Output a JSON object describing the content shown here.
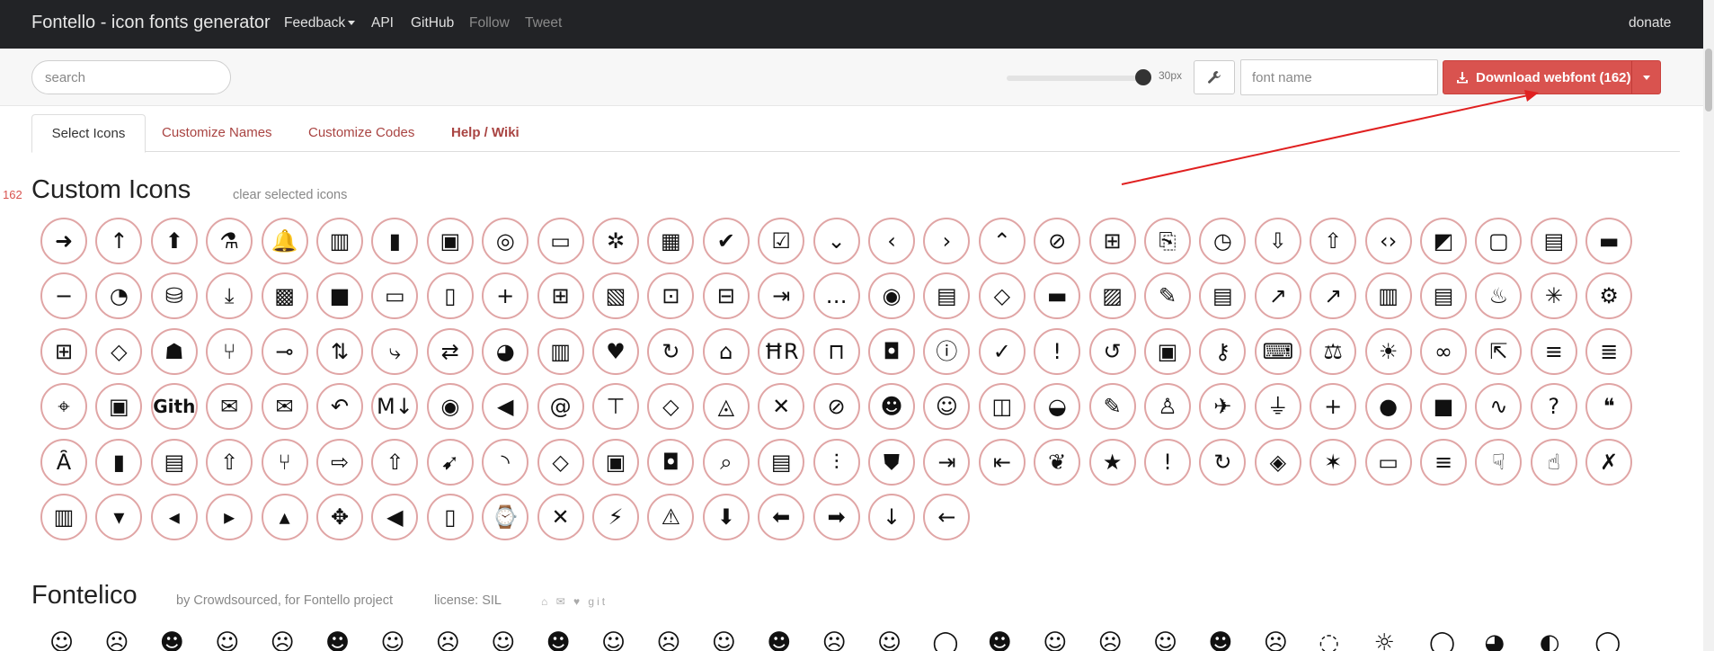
{
  "navbar": {
    "brand": "Fontello - icon fonts generator",
    "items": [
      {
        "label": "Feedback",
        "dropdown": true
      },
      {
        "label": "API"
      },
      {
        "label": "GitHub"
      },
      {
        "label": "Follow",
        "muted": true
      },
      {
        "label": "Tweet",
        "muted": true
      }
    ],
    "donate": "donate"
  },
  "toolbar": {
    "search_placeholder": "search",
    "size_label": "30px",
    "fontname_placeholder": "font name",
    "download_label": "Download webfont (162)"
  },
  "tabs": [
    {
      "label": "Select Icons",
      "active": true
    },
    {
      "label": "Customize Names"
    },
    {
      "label": "Customize Codes"
    },
    {
      "label": "Help / Wiki",
      "bold": true
    }
  ],
  "custom": {
    "count": "162",
    "title": "Custom Icons",
    "clear_label": "clear selected icons",
    "icons": [
      [
        "arrow-right-small",
        "➜"
      ],
      [
        "arrow-up-small",
        "↑"
      ],
      [
        "arrow-up",
        "⬆"
      ],
      [
        "flask",
        "⚗"
      ],
      [
        "bell",
        "🔔"
      ],
      [
        "book-open",
        "▥"
      ],
      [
        "bookmark",
        "▮"
      ],
      [
        "briefcase",
        "▣"
      ],
      [
        "broadcast",
        "◎"
      ],
      [
        "browser",
        "▭"
      ],
      [
        "bug",
        "✲"
      ],
      [
        "calendar",
        "▦"
      ],
      [
        "check",
        "✔"
      ],
      [
        "checklist",
        "☑"
      ],
      [
        "chevron-down",
        "⌄"
      ],
      [
        "chevron-left",
        "‹"
      ],
      [
        "chevron-right",
        "›"
      ],
      [
        "chevron-up",
        "⌃"
      ],
      [
        "circle-slash",
        "⊘"
      ],
      [
        "circuit-board",
        "⊞"
      ],
      [
        "clippy",
        "⎘"
      ],
      [
        "clock",
        "◷"
      ],
      [
        "cloud-download",
        "⇩"
      ],
      [
        "cloud-upload",
        "⇧"
      ],
      [
        "code",
        "‹›"
      ],
      [
        "contrast",
        "◩"
      ],
      [
        "comment",
        "▢"
      ],
      [
        "comments",
        "▤"
      ],
      [
        "credit-card",
        "▬"
      ],
      [
        "dash",
        "−"
      ],
      [
        "dashboard",
        "◔"
      ],
      [
        "database",
        "⛁"
      ],
      [
        "desktop-download",
        "⤓"
      ],
      [
        "camera",
        "▩"
      ],
      [
        "video",
        "■"
      ],
      [
        "monitor",
        "▭"
      ],
      [
        "mobile",
        "▯"
      ],
      [
        "diff-added",
        "+"
      ],
      [
        "plus-square",
        "⊞"
      ],
      [
        "diff-modified",
        "▧"
      ],
      [
        "diff-ignored",
        "⊡"
      ],
      [
        "diff-removed",
        "⊟"
      ],
      [
        "diff-renamed",
        "⇥"
      ],
      [
        "ellipsis",
        "…"
      ],
      [
        "eye",
        "◉"
      ],
      [
        "file-binary",
        "▤"
      ],
      [
        "file-code",
        "◇"
      ],
      [
        "folder",
        "▬"
      ],
      [
        "file-media",
        "▨"
      ],
      [
        "file-pdf",
        "✎"
      ],
      [
        "file-submodule",
        "▤"
      ],
      [
        "file-symlink-dir",
        "↗"
      ],
      [
        "file-symlink-file",
        "↗"
      ],
      [
        "file-zip",
        "▥"
      ],
      [
        "file-text",
        "▤"
      ],
      [
        "flame",
        "♨"
      ],
      [
        "fold",
        "✳"
      ],
      [
        "gear",
        "⚙"
      ],
      [
        "gift",
        "⊞"
      ],
      [
        "gist",
        "◇"
      ],
      [
        "incognito",
        "☗"
      ],
      [
        "git-branch",
        "⑂"
      ],
      [
        "git-commit",
        "⊸"
      ],
      [
        "git-compare",
        "⇅"
      ],
      [
        "git-merge",
        "⤷"
      ],
      [
        "git-pull-request",
        "⇄"
      ],
      [
        "globe",
        "◕"
      ],
      [
        "graph",
        "▥"
      ],
      [
        "heart",
        "♥"
      ],
      [
        "history",
        "↻"
      ],
      [
        "home",
        "⌂"
      ],
      [
        "horizontal-rule",
        "ĦR"
      ],
      [
        "inbox",
        "⊓"
      ],
      [
        "jersey",
        "◘"
      ],
      [
        "info",
        "ⓘ"
      ],
      [
        "issue-closed",
        "✓"
      ],
      [
        "issue-opened",
        "!"
      ],
      [
        "issue-reopened",
        "↺"
      ],
      [
        "jersey",
        "▣"
      ],
      [
        "key",
        "⚷"
      ],
      [
        "keyboard",
        "⌨"
      ],
      [
        "law",
        "⚖"
      ],
      [
        "light-bulb",
        "☀"
      ],
      [
        "link",
        "∞"
      ],
      [
        "link-external",
        "⇱"
      ],
      [
        "list-ordered",
        "≡"
      ],
      [
        "list-unordered",
        "≣"
      ],
      [
        "location",
        "⌖"
      ],
      [
        "lock",
        "▣"
      ],
      [
        "logo-github",
        "Gith"
      ],
      [
        "mail",
        "✉"
      ],
      [
        "mail-read",
        "✉"
      ],
      [
        "reply",
        "↶"
      ],
      [
        "markdown",
        "M↓"
      ],
      [
        "mark-github",
        "◉"
      ],
      [
        "megaphone",
        "◀"
      ],
      [
        "mention",
        "@"
      ],
      [
        "milestone",
        "⊤"
      ],
      [
        "mirror",
        "◇"
      ],
      [
        "mortar-board",
        "◬"
      ],
      [
        "mute",
        "✕"
      ],
      [
        "no-newline",
        "⊘"
      ],
      [
        "octoface",
        "☻"
      ],
      [
        "organization",
        "☺"
      ],
      [
        "package",
        "◫"
      ],
      [
        "paintcan",
        "◒"
      ],
      [
        "pencil",
        "✎"
      ],
      [
        "person",
        "♙"
      ],
      [
        "pin",
        "✈"
      ],
      [
        "plug",
        "⏚"
      ],
      [
        "plus",
        "+"
      ],
      [
        "primitive-dot",
        "●"
      ],
      [
        "primitive-square",
        "■"
      ],
      [
        "pulse",
        "∿"
      ],
      [
        "question",
        "?"
      ],
      [
        "quote",
        "❝"
      ],
      [
        "radio-tower",
        "Ȃ"
      ],
      [
        "repo",
        "▮"
      ],
      [
        "repo-clone",
        "▤"
      ],
      [
        "repo-force-push",
        "⇧"
      ],
      [
        "repo-forked",
        "⑂"
      ],
      [
        "repo-pull",
        "⇨"
      ],
      [
        "repo-push",
        "⇧"
      ],
      [
        "rocket",
        "➹"
      ],
      [
        "rss",
        "◝"
      ],
      [
        "ruby",
        "◇"
      ],
      [
        "screen-full",
        "▣"
      ],
      [
        "screen-normal",
        "◘"
      ],
      [
        "search",
        "⌕"
      ],
      [
        "server",
        "▤"
      ],
      [
        "settings",
        "⫶"
      ],
      [
        "shield",
        "⛊"
      ],
      [
        "sign-in",
        "⇥"
      ],
      [
        "sign-out",
        "⇤"
      ],
      [
        "squirrel",
        "❦"
      ],
      [
        "star",
        "★"
      ],
      [
        "stop",
        "!"
      ],
      [
        "sync",
        "↻"
      ],
      [
        "tag",
        "◈"
      ],
      [
        "telescope",
        "✶"
      ],
      [
        "terminal",
        "▭"
      ],
      [
        "three-bars",
        "≡"
      ],
      [
        "thumbsdown",
        "☟"
      ],
      [
        "thumbsup",
        "☝"
      ],
      [
        "tools",
        "✗"
      ],
      [
        "trashcan",
        "▥"
      ],
      [
        "triangle-down",
        "▾"
      ],
      [
        "triangle-left",
        "◂"
      ],
      [
        "triangle-right",
        "▸"
      ],
      [
        "triangle-up",
        "▴"
      ],
      [
        "unfold",
        "✥"
      ],
      [
        "unmute",
        "◀"
      ],
      [
        "unverified",
        "▯"
      ],
      [
        "watch",
        "⌚"
      ],
      [
        "x",
        "✕"
      ],
      [
        "zap",
        "⚡"
      ],
      [
        "alert",
        "⚠"
      ],
      [
        "arrow-down",
        "⬇"
      ],
      [
        "arrow-left",
        "⬅"
      ],
      [
        "arrow-right",
        "➡"
      ],
      [
        "arrow-small-down",
        "↓"
      ],
      [
        "arrow-small-left",
        "←"
      ]
    ]
  },
  "fontelico": {
    "title": "Fontelico",
    "author": "by Crowdsourced, for Fontello project",
    "license": "license: SIL",
    "share_icons": "⌂ ✉ ♥ git",
    "icons": [
      "☺",
      "☹",
      "☻",
      "☺",
      "☹",
      "☻",
      "☺",
      "☹",
      "☺",
      "☻",
      "☺",
      "☹",
      "☺",
      "☻",
      "☹",
      "☺",
      "◯",
      "☻",
      "☺",
      "☹",
      "☺",
      "☻",
      "☹",
      "◌",
      "☼",
      "◯",
      "◕",
      "◐",
      "◯"
    ]
  },
  "colors": {
    "navbar_bg": "#222326",
    "accent": "#d9534f",
    "icon_border": "#e0a5a5"
  }
}
